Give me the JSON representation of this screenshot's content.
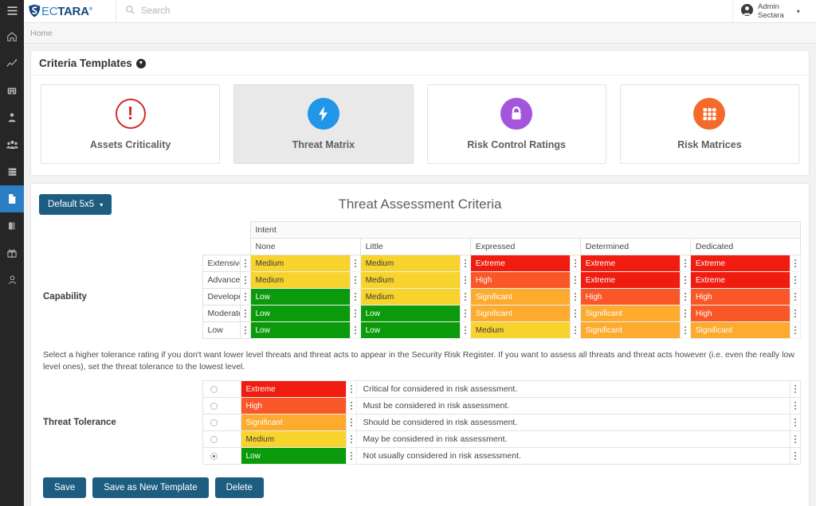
{
  "colors": {
    "extreme": "#ef1c0f",
    "high": "#fa5728",
    "significant": "#fcab2f",
    "medium": "#f7d32e",
    "low": "#0b9a0b",
    "accent": "#1d5d80",
    "rail_active": "#2a7fc4"
  },
  "topbar": {
    "menu_icon": "hamburger-icon",
    "brand_part1": "EC",
    "brand_part2": "TARA",
    "brand_reg": "®",
    "search_placeholder": "Search",
    "search_value": "",
    "search_icon": "search-icon",
    "user_line1": "Admin",
    "user_line2": "Sectara",
    "user_icon": "user-circle-icon",
    "user_caret": "▾"
  },
  "sidebar": {
    "items": [
      {
        "name": "home",
        "icon": "home-icon",
        "active": false
      },
      {
        "name": "analytics",
        "icon": "trending-line-icon",
        "active": false
      },
      {
        "name": "organisation",
        "icon": "building-icon",
        "active": false
      },
      {
        "name": "personnel",
        "icon": "user-tie-icon",
        "active": false
      },
      {
        "name": "teams",
        "icon": "people-group-icon",
        "active": false
      },
      {
        "name": "assets",
        "icon": "server-stack-icon",
        "active": false
      },
      {
        "name": "criteria-templates",
        "icon": "document-icon",
        "active": true
      },
      {
        "name": "library",
        "icon": "book-icon",
        "active": false
      },
      {
        "name": "whats-new",
        "icon": "gift-icon",
        "active": false
      },
      {
        "name": "account",
        "icon": "person-icon",
        "active": false
      }
    ]
  },
  "breadcrumb": {
    "items": [
      "Home"
    ]
  },
  "criteria_templates": {
    "title": "Criteria Templates",
    "caret_icon": "chevron-down-circle-icon",
    "tiles": [
      {
        "label": "Assets Criticality",
        "icon": "exclamation-circle-icon",
        "glyph": "!",
        "color": "#d32b2b",
        "style": "ring",
        "selected": false
      },
      {
        "label": "Threat Matrix",
        "icon": "lightning-bolt-icon",
        "glyph": "⚡",
        "color": "#2196e8",
        "style": "filled",
        "selected": true
      },
      {
        "label": "Risk Control Ratings",
        "icon": "lock-icon",
        "glyph": "lock",
        "color": "#a356db",
        "style": "filled",
        "selected": false
      },
      {
        "label": "Risk Matrices",
        "icon": "grid-icon",
        "glyph": "grid",
        "color": "#f4692c",
        "style": "filled",
        "selected": false
      }
    ]
  },
  "threat_matrix": {
    "template_button": "Default 5x5",
    "template_caret": "▾",
    "title": "Threat Assessment Criteria",
    "col_axis_label": "Intent",
    "row_axis_label": "Capability",
    "col_headers": [
      "None",
      "Little",
      "Expressed",
      "Determined",
      "Dedicated"
    ],
    "row_headers": [
      "Extensive",
      "Advanced",
      "Developed",
      "Moderate",
      "Low"
    ],
    "drag_handle_icon": "drag-dots-icon",
    "cells": [
      [
        "Medium",
        "Medium",
        "Extreme",
        "Extreme",
        "Extreme"
      ],
      [
        "Medium",
        "Medium",
        "High",
        "Extreme",
        "Extreme"
      ],
      [
        "Low",
        "Medium",
        "Significant",
        "High",
        "High"
      ],
      [
        "Low",
        "Low",
        "Significant",
        "Significant",
        "High"
      ],
      [
        "Low",
        "Low",
        "Medium",
        "Significant",
        "Significant"
      ]
    ]
  },
  "tolerance": {
    "help_text": "Select a higher tolerance rating if you don't want lower level threats and threat acts to appear in the Security Risk Register. If you want to assess all threats and threat acts however (i.e. even the really low level ones), set the threat tolerance to the lowest level.",
    "label": "Threat Tolerance",
    "drag_handle_icon": "drag-dots-icon",
    "rows": [
      {
        "level": "Extreme",
        "description": "Critical for considered in risk assessment.",
        "selected": false
      },
      {
        "level": "High",
        "description": "Must be considered in risk assessment.",
        "selected": false
      },
      {
        "level": "Significant",
        "description": "Should be considered in risk assessment.",
        "selected": false
      },
      {
        "level": "Medium",
        "description": "May be considered in risk assessment.",
        "selected": false
      },
      {
        "level": "Low",
        "description": "Not usually considered in risk assessment.",
        "selected": true
      }
    ]
  },
  "actions": {
    "save": "Save",
    "save_as_new": "Save as New Template",
    "delete": "Delete"
  }
}
